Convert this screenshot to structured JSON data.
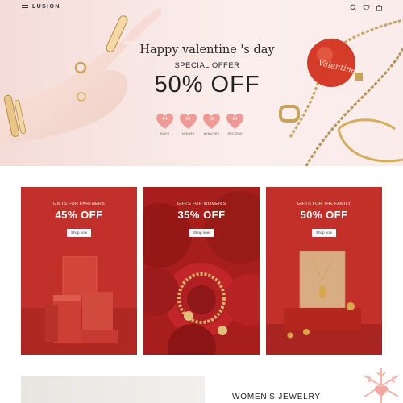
{
  "header": {
    "logo": "LUSION",
    "icons": [
      "menu-icon",
      "search-icon",
      "heart-icon",
      "bag-icon"
    ]
  },
  "hero": {
    "title": "Happy valentine 's day",
    "subtitle": "SPECIAL OFFER",
    "discount": "50% OFF",
    "ornament_text": "Valentine",
    "countdown": [
      {
        "value": "04",
        "label": "DAYS"
      },
      {
        "value": "09",
        "label": "HOURS"
      },
      {
        "value": "16",
        "label": "MINUTES"
      },
      {
        "value": "24",
        "label": "SECOND"
      }
    ]
  },
  "cards": [
    {
      "subtitle": "GIFTS FOR PARTNERS",
      "discount": "45% OFF",
      "button": "Shop now"
    },
    {
      "subtitle": "GIFTS FOR WOMEN'S",
      "discount": "35% OFF",
      "button": "Shop now"
    },
    {
      "subtitle": "GIFTS FOR THE FAMILY",
      "discount": "50% OFF",
      "button": "Shop now"
    }
  ],
  "bottom": {
    "section_title": "WOMEN'S JEWELRY"
  },
  "colors": {
    "accent_red": "#c0322a",
    "heart_pink": "#ef9a96",
    "gold": "#c9a35b"
  }
}
